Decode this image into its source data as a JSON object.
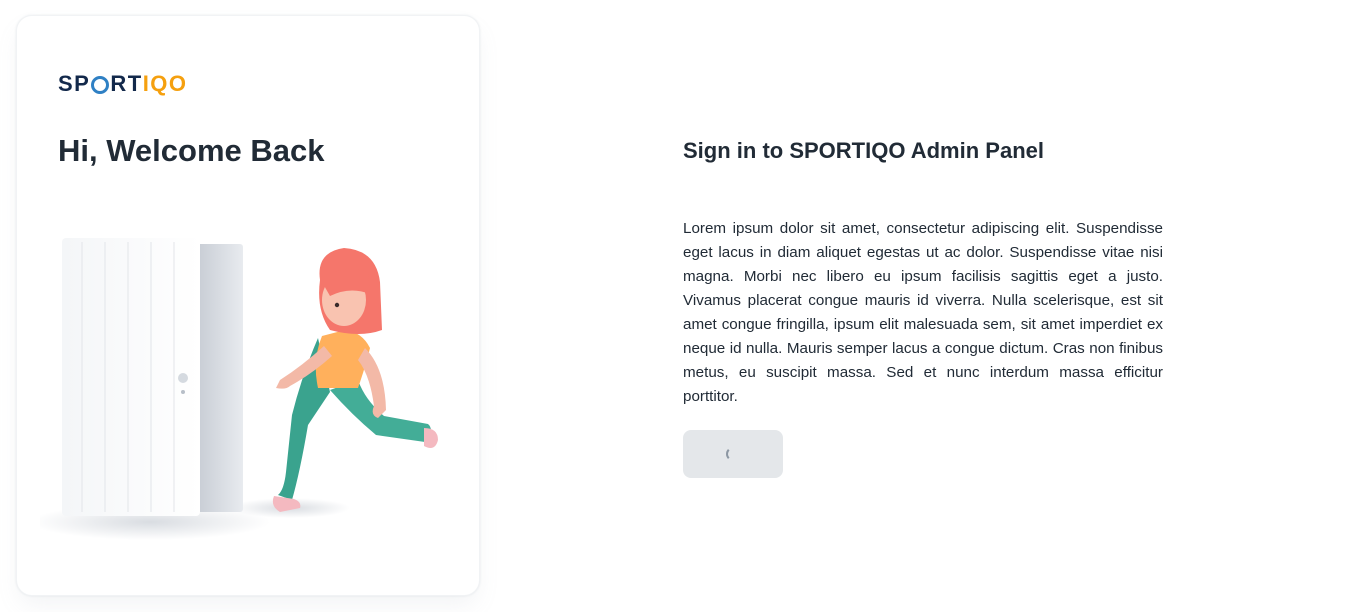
{
  "brand": {
    "part1": "SP",
    "part2": "RT",
    "part3": "IQO",
    "full_name": "SPORTIQO",
    "colors": {
      "dark": "#13294b",
      "accent": "#f5a00f",
      "mark": "#2f80c4"
    }
  },
  "left_panel": {
    "heading": "Hi, Welcome Back",
    "illustration": "girl-running-out-of-door-illustration"
  },
  "form": {
    "title": "Sign in to SPORTIQO Admin Panel",
    "description": "Lorem ipsum dolor sit amet, consectetur adipiscing elit. Suspendisse eget lacus in diam aliquet egestas ut ac dolor. Suspendisse vitae nisi magna. Morbi nec libero eu ipsum facilisis sagittis eget a justo. Vivamus placerat congue mauris id viverra. Nulla scelerisque, est sit amet congue fringilla, ipsum elit malesuada sem, sit amet imperdiet ex neque id nulla. Mauris semper lacus a congue dictum. Cras non finibus metus, eu suscipit massa. Sed et nunc interdum massa efficitur porttitor.",
    "signin_button": {
      "state": "loading",
      "icon": "spinner-icon"
    }
  }
}
